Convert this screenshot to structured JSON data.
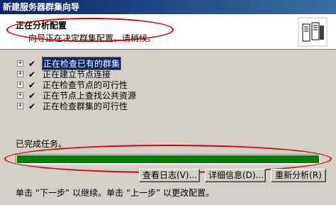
{
  "window": {
    "title": "新建服务器群集向导"
  },
  "header": {
    "title": "正在分析配置",
    "subtitle": "向导正在决定群集配置，请稍候。",
    "icon": "server-cluster-icon"
  },
  "tasks": [
    {
      "label": "正在检查已有的群集",
      "expander": "+",
      "check": "✔",
      "selected": true
    },
    {
      "label": "正在建立节点连接",
      "expander": "+",
      "check": "✔",
      "selected": false
    },
    {
      "label": "正在检查节点的可行性",
      "expander": "+",
      "check": "✔",
      "selected": false
    },
    {
      "label": "正在节点上查找公共资源",
      "expander": "+",
      "check": "✔",
      "selected": false
    },
    {
      "label": "正在检查群集的可行性",
      "expander": "+",
      "check": "✔",
      "selected": false
    }
  ],
  "status": {
    "text": "已完成任务。"
  },
  "progress": {
    "value_percent": 100,
    "color": "#008000"
  },
  "buttons": {
    "view_log": "查看日志(V)...",
    "details": "详细信息(D)...",
    "reanalyze": "重新分析(R)"
  },
  "footer": {
    "text": "单击 “下一步” 以继续。单击 “上一步” 以更改配置。"
  },
  "annotation_color": "#d40000"
}
